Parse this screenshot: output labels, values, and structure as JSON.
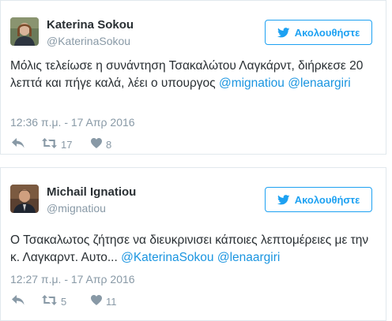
{
  "tweets": [
    {
      "author_name": "Katerina Sokou",
      "handle": "@KaterinaSokou",
      "follow_label": "Ακολουθήστε",
      "text_before": "Μόλις τελείωσε η συνάντηση Τσακαλώτου Λαγκάρντ, διήρκεσε 20 λεπτά και πήγε καλά, λέει ο υπουργος ",
      "mention_1": "@mignatiou",
      "text_between": " ",
      "mention_2": "@lenaargiri",
      "timestamp": "12:36 π.μ. - 17 Απρ 2016",
      "retweet_count": "17",
      "like_count": "8"
    },
    {
      "author_name": "Michail Ignatiou",
      "handle": "@mignatiou",
      "follow_label": "Ακολουθήστε",
      "text_before": "Ο Τσακαλωτος ζήτησε να διευκρινισει κάποιες λεπτομέρειες με την κ. Λαγκαρντ. Αυτο... ",
      "mention_1": "@KaterinaSokou",
      "text_between": " ",
      "mention_2": "@lenaargiri",
      "timestamp": "12:27 π.μ. - 17 Απρ 2016",
      "retweet_count": "5",
      "like_count": "11"
    }
  ],
  "colors": {
    "accent": "#1da1f2",
    "link": "#1b95e0",
    "muted": "#8899a6",
    "border": "#e1e8ed",
    "text": "#292f33"
  },
  "icons": {
    "follow": "twitter-bird-icon",
    "reply": "reply-icon",
    "retweet": "retweet-icon",
    "like": "heart-icon"
  }
}
